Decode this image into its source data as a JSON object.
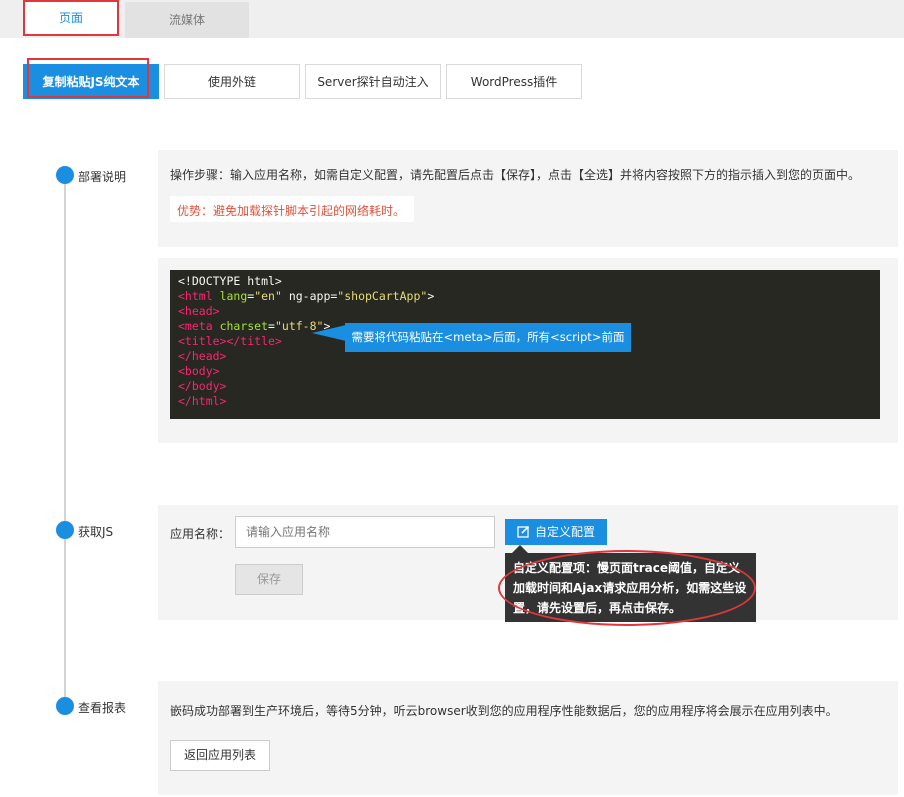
{
  "top_tabs": [
    {
      "label": "页面"
    },
    {
      "label": "流媒体"
    }
  ],
  "sub_tabs": [
    {
      "label": "复制粘贴JS纯文本"
    },
    {
      "label": "使用外链"
    },
    {
      "label": "Server探针自动注入"
    },
    {
      "label": "WordPress插件"
    }
  ],
  "steps": {
    "deploy": {
      "label": "部署说明",
      "instructions": "操作步骤：输入应用名称，如需自定义配置，请先配置后点击【保存】，点击【全选】并将内容按照下方的指示插入到您的页面中。",
      "advantage": "优势：避免加载探针脚本引起的网络耗时。",
      "code_lines": [
        "<!DOCTYPE html>",
        "<html lang=\"en\" ng-app=\"shopCartApp\">",
        "<head>",
        "<meta charset=\"utf-8\">",
        "<title></title>",
        "</head>",
        "<body>",
        "</body>",
        "</html>"
      ],
      "code_hint": "需要将代码粘贴在<meta>后面，所有<script>前面"
    },
    "get_js": {
      "label": "获取JS",
      "app_name_label": "应用名称：",
      "app_name_placeholder": "请输入应用名称",
      "custom_button": "自定义配置",
      "save_button": "保存",
      "tooltip": "自定义配置项：慢页面trace阈值，自定义加载时间和Ajax请求应用分析，如需这些设置，请先设置后，再点击保存。"
    },
    "report": {
      "label": "查看报表",
      "text": "嵌码成功部署到生产环境后，等待5分钟，听云browser收到您的应用程序性能数据后，您的应用程序将会展示在应用列表中。",
      "back_button": "返回应用列表"
    }
  },
  "colors": {
    "accent": "#1a8ee0",
    "highlight": "#e0373b",
    "advantage_text": "#e0533b",
    "code_bg": "#272822"
  }
}
